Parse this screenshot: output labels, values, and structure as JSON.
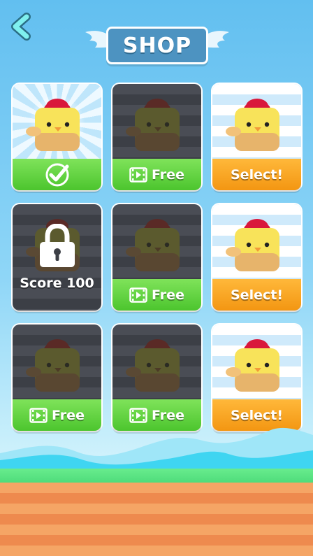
{
  "header": {
    "title": "SHOP",
    "back_icon": "chevron-left-icon"
  },
  "colors": {
    "sky_top": "#62bff0",
    "title_box": "#4d93c1",
    "card_green": "#4cc52e",
    "card_orange": "#f39612",
    "grass": "#4fdc7b",
    "dirt_light": "#f5a565",
    "dirt_dark": "#ee8a4e"
  },
  "cards": [
    {
      "state": "selected",
      "label": "",
      "icon": "checkmark-icon"
    },
    {
      "state": "video_locked",
      "label": "Free",
      "icon": "video-icon"
    },
    {
      "state": "owned",
      "label": "Select!",
      "icon": ""
    },
    {
      "state": "score_locked",
      "label": "Score 100",
      "icon": "padlock-icon"
    },
    {
      "state": "video_locked",
      "label": "Free",
      "icon": "video-icon"
    },
    {
      "state": "owned",
      "label": "Select!",
      "icon": ""
    },
    {
      "state": "video_locked",
      "label": "Free",
      "icon": "video-icon"
    },
    {
      "state": "video_locked",
      "label": "Free",
      "icon": "video-icon"
    },
    {
      "state": "owned",
      "label": "Select!",
      "icon": ""
    }
  ]
}
